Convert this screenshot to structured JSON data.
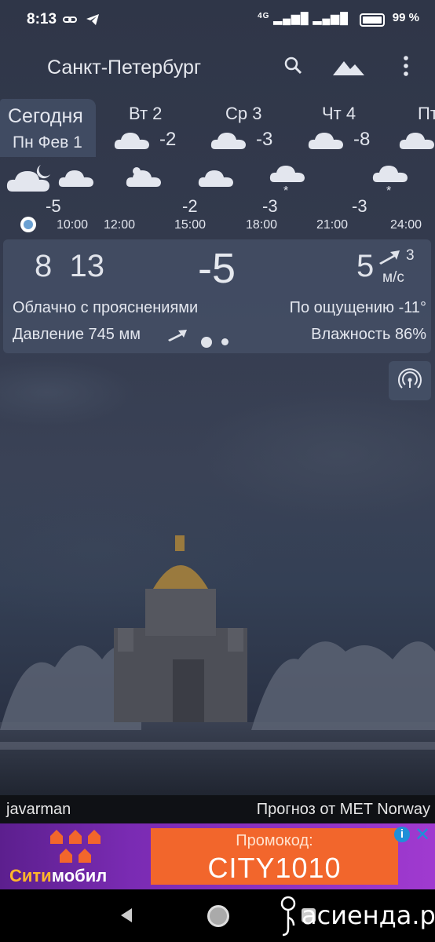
{
  "status_bar": {
    "time": "8:13",
    "network": "4G",
    "battery": "99 %"
  },
  "header": {
    "city": "Санкт-Петербург"
  },
  "days": [
    {
      "name": "Сегодня",
      "date": "Пн Фев 1",
      "selected": true
    },
    {
      "name": "Вт 2",
      "temp": "-2"
    },
    {
      "name": "Ср 3",
      "temp": "-3"
    },
    {
      "name": "Чт 4",
      "temp": "-8"
    },
    {
      "name": "Пт"
    }
  ],
  "hourly": {
    "temps": [
      "-5",
      "-2",
      "-3",
      "-3"
    ],
    "times": [
      "10:00",
      "12:00",
      "15:00",
      "18:00",
      "21:00",
      "24:00"
    ]
  },
  "current": {
    "time": "8  13",
    "temperature": "-5",
    "wind_speed": "5",
    "wind_gust": "3",
    "wind_unit": "м/с",
    "description": "Облачно с прояснениями",
    "feels_like": "По ощущению -11°",
    "pressure": "Давление 745 мм",
    "humidity": "Влажность 86%"
  },
  "footer": {
    "photo_author": "javarman",
    "forecast_source": "Прогноз от MET Norway"
  },
  "ad": {
    "brand_part1": "Сити",
    "brand_part2": "мобил",
    "promo_label": "Промокод:",
    "promo_code": "CITY1010",
    "close_symbol": "✕",
    "info_symbol": "i"
  },
  "watermark": "асиенда.ру",
  "icons": [
    "link-icon",
    "telegram-icon",
    "search-icon",
    "landscape-icon",
    "more-vert-icon",
    "cloud-icon",
    "moon-cloud-icon",
    "snow-cloud-icon",
    "wind-arrow-icon",
    "radar-icon"
  ],
  "colors": {
    "accent_orange": "#f2662c",
    "ad_purple": "#7a2bb3",
    "now_dot": "#6aa0d2"
  }
}
